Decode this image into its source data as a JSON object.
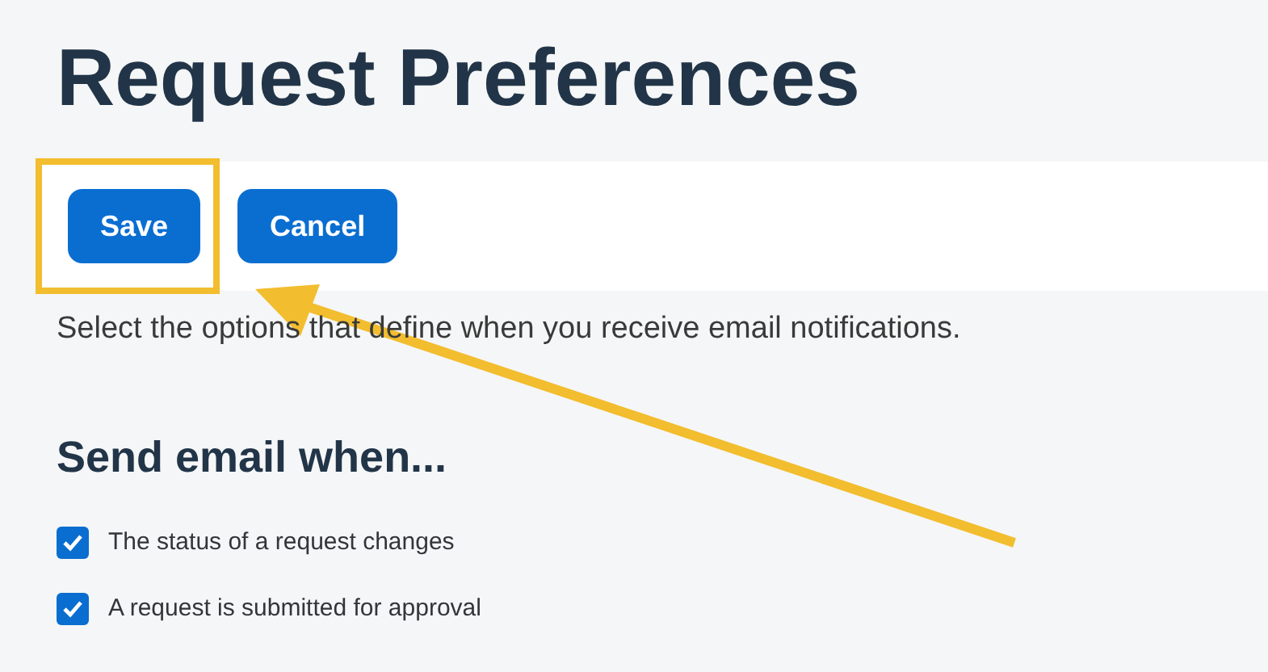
{
  "title": "Request Preferences",
  "buttons": [
    {
      "label": "Save",
      "highlighted": true
    },
    {
      "label": "Cancel",
      "highlighted": false
    }
  ],
  "description": "Select the options that define when you receive email notifications.",
  "section_title": "Send email when...",
  "options": [
    {
      "label": "The status of a request changes",
      "checked": true
    },
    {
      "label": "A request is submitted for approval",
      "checked": true
    }
  ]
}
